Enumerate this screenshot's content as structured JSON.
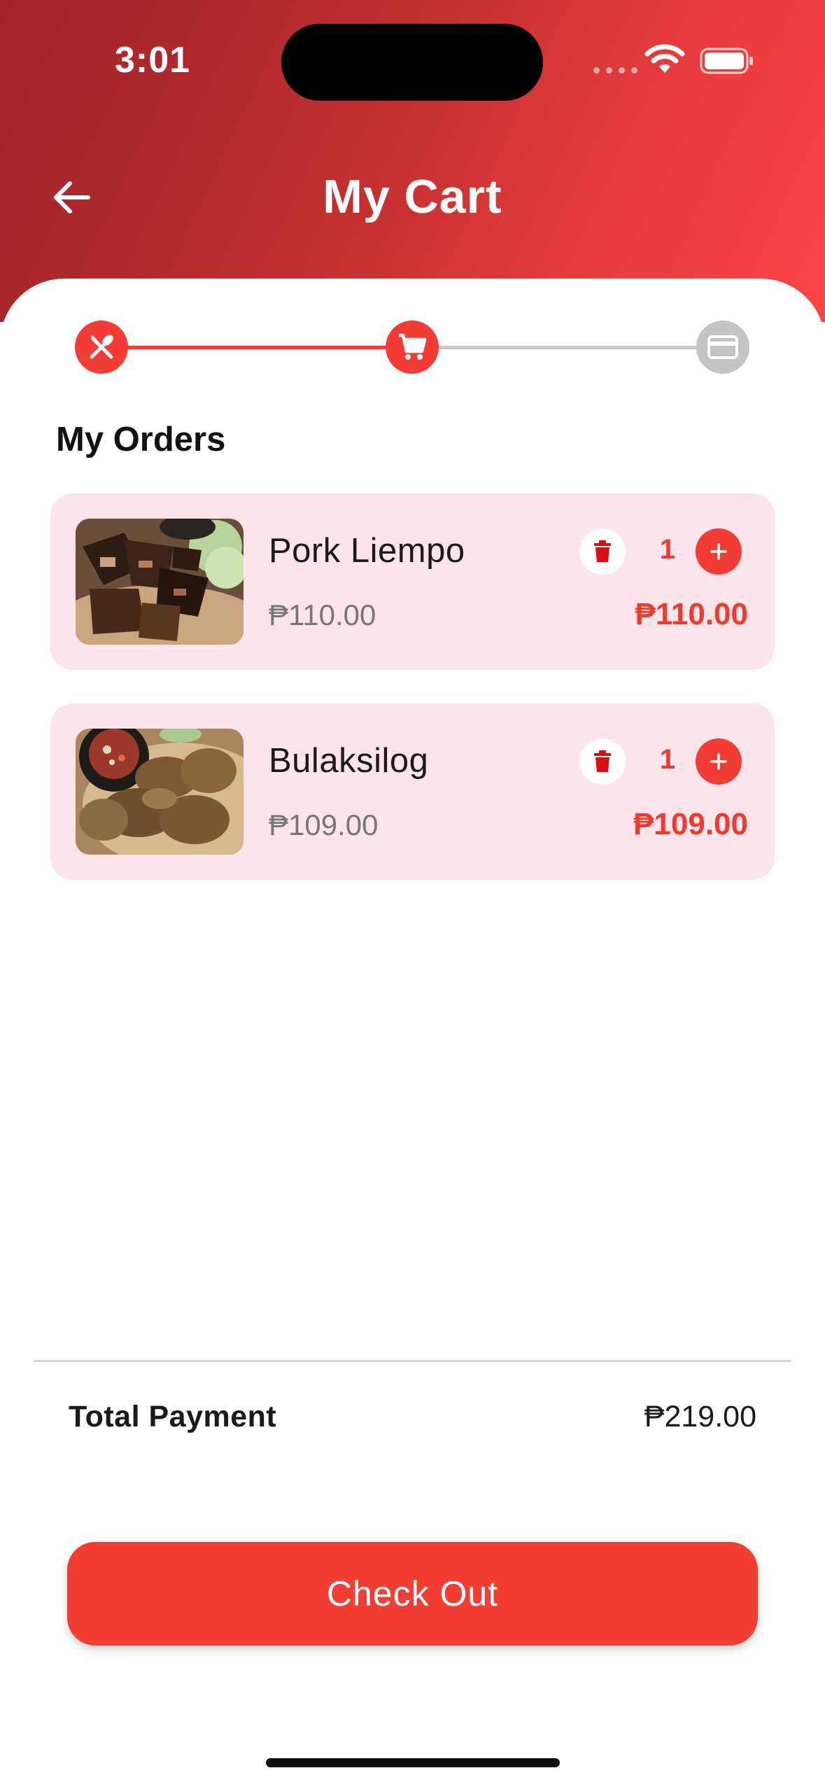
{
  "status_bar": {
    "time": "3:01"
  },
  "header": {
    "title": "My Cart",
    "back_icon": "arrow-left-icon"
  },
  "stepper": {
    "steps": [
      {
        "icon": "fork-knife-icon",
        "state": "completed"
      },
      {
        "icon": "cart-icon",
        "state": "current"
      },
      {
        "icon": "credit-card-icon",
        "state": "pending"
      }
    ]
  },
  "orders": {
    "title": "My Orders",
    "items": [
      {
        "name": "Pork Liempo",
        "unit_price": "₱110.00",
        "quantity": "1",
        "line_total": "₱110.00"
      },
      {
        "name": "Bulaksilog",
        "unit_price": "₱109.00",
        "quantity": "1",
        "line_total": "₱109.00"
      }
    ]
  },
  "summary": {
    "label": "Total Payment",
    "value": "₱219.00"
  },
  "checkout": {
    "label": "Check Out"
  },
  "colors": {
    "accent": "#f33c35",
    "card_bg": "#fbe4ea",
    "header_dark": "#9e2327",
    "header_light": "#fb4547"
  }
}
